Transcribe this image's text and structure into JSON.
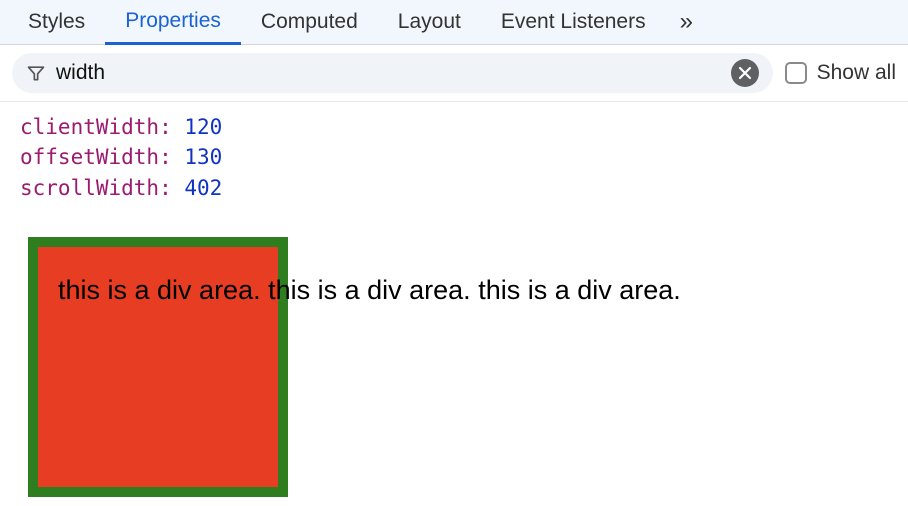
{
  "tabs": {
    "items": [
      {
        "label": "Styles",
        "active": false
      },
      {
        "label": "Properties",
        "active": true
      },
      {
        "label": "Computed",
        "active": false
      },
      {
        "label": "Layout",
        "active": false
      },
      {
        "label": "Event Listeners",
        "active": false
      }
    ],
    "more_glyph": "»"
  },
  "filter": {
    "value": "width",
    "placeholder": "Filter"
  },
  "showall": {
    "label": "Show all",
    "checked": false
  },
  "properties": [
    {
      "key": "clientWidth",
      "value": "120"
    },
    {
      "key": "offsetWidth",
      "value": "130"
    },
    {
      "key": "scrollWidth",
      "value": "402"
    }
  ],
  "demo": {
    "text": "this is a div area. this is a div area. this is a div area.",
    "border_color": "#2e7d1e",
    "bg_color": "#e73d23"
  }
}
